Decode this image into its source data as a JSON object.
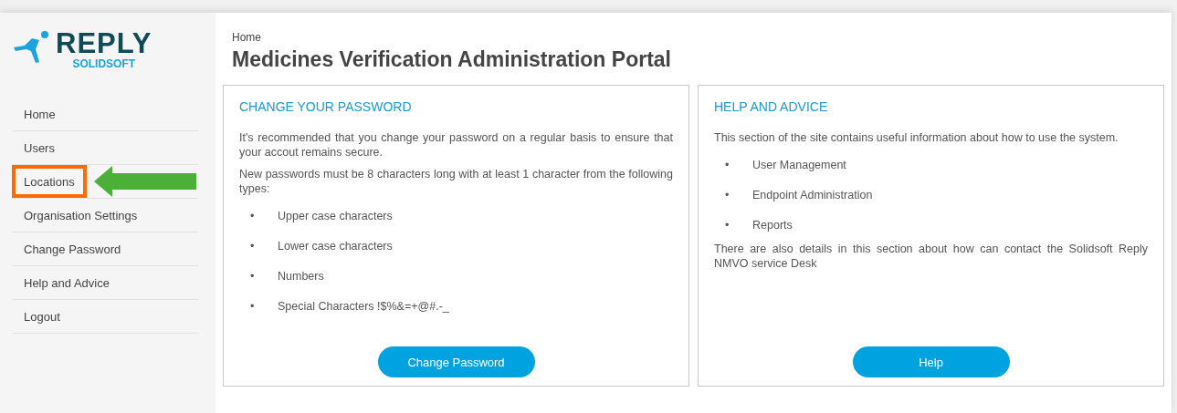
{
  "logo": {
    "name": "REPLY",
    "sub": "SOLIDSOFT"
  },
  "nav": [
    {
      "label": "Home",
      "highlighted": false
    },
    {
      "label": "Users",
      "highlighted": false
    },
    {
      "label": "Locations",
      "highlighted": true
    },
    {
      "label": "Organisation Settings",
      "highlighted": false
    },
    {
      "label": "Change Password",
      "highlighted": false
    },
    {
      "label": "Help and Advice",
      "highlighted": false
    },
    {
      "label": "Logout",
      "highlighted": false
    }
  ],
  "breadcrumb": "Home",
  "title": "Medicines Verification Administration Portal",
  "cards": [
    {
      "heading": "CHANGE YOUR PASSWORD",
      "marker": "•",
      "intro": [
        "It's recommended that you change your password on a regular basis to ensure that your accout remains secure.",
        "New passwords must be 8 characters long with at least 1 character from the following types:"
      ],
      "bullets": [
        "Upper case characters",
        "Lower case characters",
        "Numbers",
        "Special Characters !$%&=+@#.-_"
      ],
      "button": "Change Password"
    },
    {
      "heading": "HELP AND ADVICE",
      "marker": "•",
      "intro": [
        "This section of the site contains useful information about how to use the system."
      ],
      "bullets": [
        "User Management",
        "Endpoint Administration",
        "Reports"
      ],
      "outro": [
        "There are also details in this section about how can contact the Solidsoft Reply NMVO service Desk"
      ],
      "button": "Help"
    }
  ]
}
